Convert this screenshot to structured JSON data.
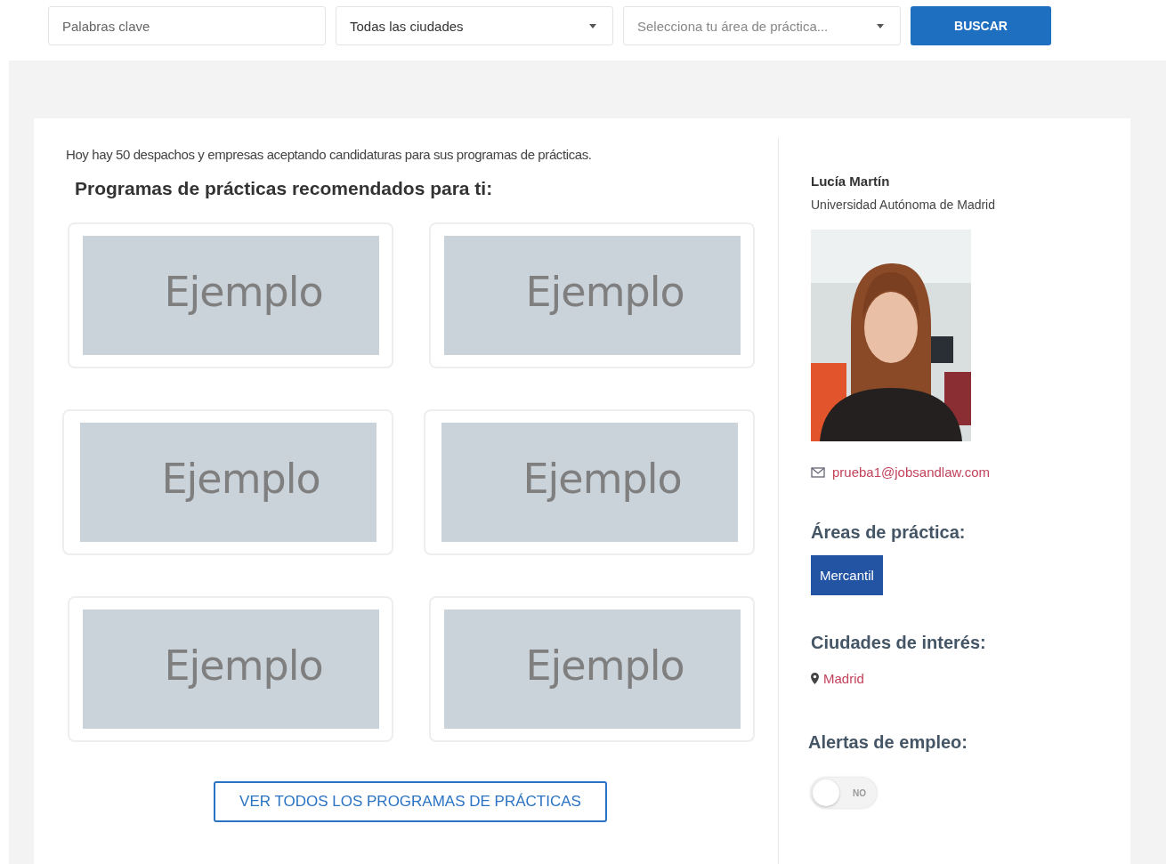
{
  "search_bar": {
    "keywords": {
      "placeholder": "Palabras clave"
    },
    "city": {
      "value": "Todas las ciudades"
    },
    "area": {
      "placeholder": "Selecciona tu área de práctica..."
    },
    "button": "BUSCAR"
  },
  "main": {
    "intro": "Hoy hay 50 despachos y empresas aceptando candidaturas para sus programas de prácticas.",
    "heading": "Programas de prácticas recomendados para ti:",
    "cards": [
      {
        "overlay": "Ejemplo"
      },
      {
        "overlay": "Ejemplo"
      },
      {
        "overlay": "Ejemplo"
      },
      {
        "overlay": "Ejemplo"
      },
      {
        "overlay": "Ejemplo"
      },
      {
        "overlay": "Ejemplo"
      }
    ],
    "all_button": "VER TODOS LOS PROGRAMAS DE PRÁCTICAS"
  },
  "profile": {
    "name": "Lucía Martín",
    "university": "Universidad Autónoma de Madrid",
    "email": "prueba1@jobsandlaw.com",
    "areas_heading": "Áreas de práctica:",
    "areas": [
      "Mercantil"
    ],
    "cities_heading": "Ciudades de interés:",
    "cities": [
      "Madrid"
    ],
    "alerts_heading": "Alertas de empleo:",
    "alerts": {
      "on": false,
      "label": "NO"
    }
  }
}
